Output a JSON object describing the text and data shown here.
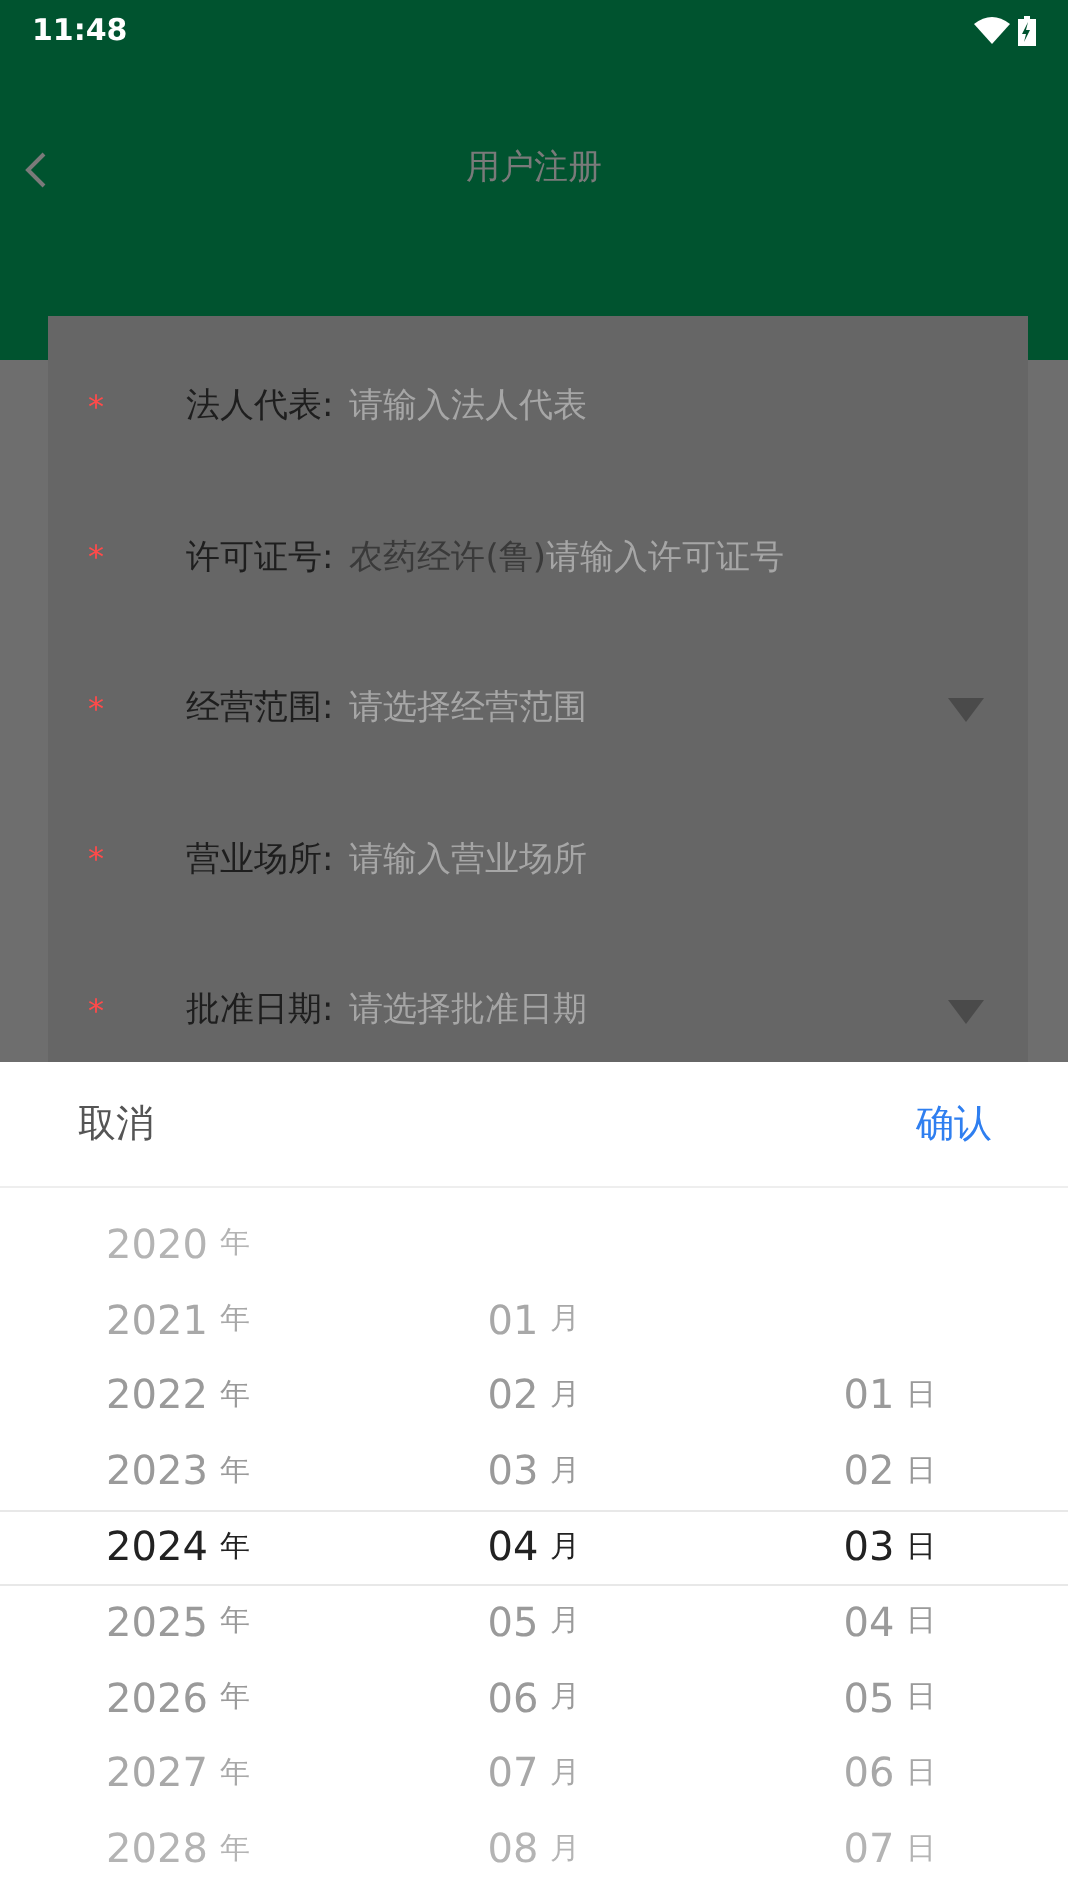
{
  "status_bar": {
    "time": "11:48"
  },
  "header": {
    "title": "用户注册"
  },
  "form": [
    {
      "kind": "input",
      "required_mark": "*",
      "label": "法人代表:",
      "placeholder": "请输入法人代表"
    },
    {
      "kind": "input",
      "required_mark": "*",
      "label": "许可证号:",
      "prefix": "农药经许(鲁)",
      "placeholder": "请输入许可证号"
    },
    {
      "kind": "select",
      "required_mark": "*",
      "label": "经营范围:",
      "placeholder": "请选择经营范围"
    },
    {
      "kind": "input",
      "required_mark": "*",
      "label": "营业场所:",
      "placeholder": "请输入营业场所"
    },
    {
      "kind": "select",
      "required_mark": "*",
      "label": "批准日期:",
      "placeholder": "请选择批准日期"
    }
  ],
  "date_picker": {
    "cancel": "取消",
    "confirm": "确认",
    "columns": [
      {
        "items": [
          {
            "value": "2020",
            "unit": "年",
            "selected": false
          },
          {
            "value": "2021",
            "unit": "年",
            "selected": false
          },
          {
            "value": "2022",
            "unit": "年",
            "selected": false
          },
          {
            "value": "2023",
            "unit": "年",
            "selected": false
          },
          {
            "value": "2024",
            "unit": "年",
            "selected": true
          },
          {
            "value": "2025",
            "unit": "年",
            "selected": false
          },
          {
            "value": "2026",
            "unit": "年",
            "selected": false
          },
          {
            "value": "2027",
            "unit": "年",
            "selected": false
          },
          {
            "value": "2028",
            "unit": "年",
            "selected": false
          }
        ]
      },
      {
        "items": [
          {
            "value": "01",
            "unit": "月",
            "selected": false
          },
          {
            "value": "02",
            "unit": "月",
            "selected": false
          },
          {
            "value": "03",
            "unit": "月",
            "selected": false
          },
          {
            "value": "04",
            "unit": "月",
            "selected": true
          },
          {
            "value": "05",
            "unit": "月",
            "selected": false
          },
          {
            "value": "06",
            "unit": "月",
            "selected": false
          },
          {
            "value": "07",
            "unit": "月",
            "selected": false
          },
          {
            "value": "08",
            "unit": "月",
            "selected": false
          }
        ]
      },
      {
        "items": [
          {
            "value": "01",
            "unit": "日",
            "selected": false
          },
          {
            "value": "02",
            "unit": "日",
            "selected": false
          },
          {
            "value": "03",
            "unit": "日",
            "selected": true
          },
          {
            "value": "04",
            "unit": "日",
            "selected": false
          },
          {
            "value": "05",
            "unit": "日",
            "selected": false
          },
          {
            "value": "06",
            "unit": "日",
            "selected": false
          },
          {
            "value": "07",
            "unit": "日",
            "selected": false
          }
        ]
      }
    ]
  }
}
